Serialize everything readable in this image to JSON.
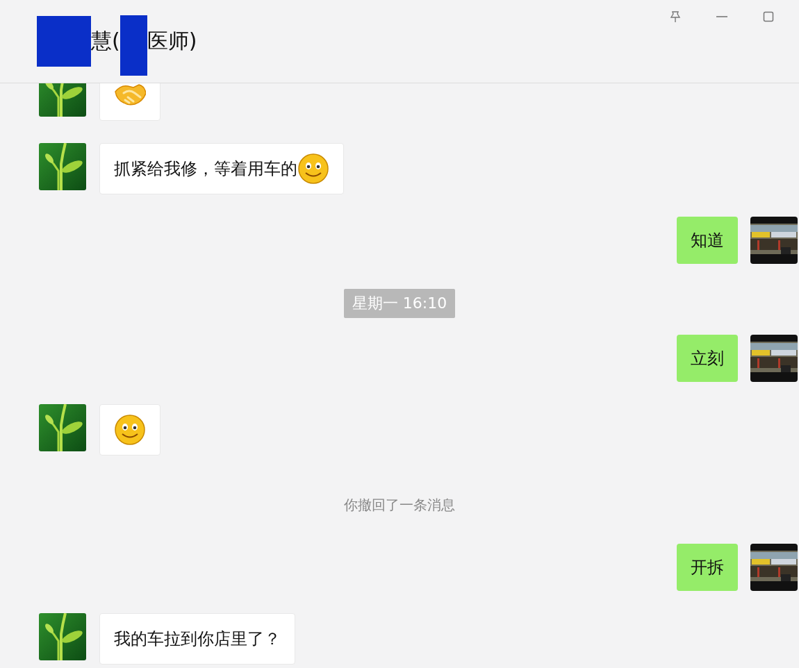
{
  "window": {
    "title": [
      {
        "kind": "redaction"
      },
      {
        "kind": "text",
        "text": "慧("
      },
      {
        "kind": "redaction"
      },
      {
        "kind": "text",
        "text": "医师)"
      }
    ],
    "controls": [
      {
        "kind": "pin"
      },
      {
        "kind": "minimize"
      },
      {
        "kind": "maximize"
      }
    ]
  },
  "messages": [
    {
      "kind": "incoming",
      "emoji": {
        "kind": "handshake"
      }
    },
    {
      "kind": "incoming",
      "text": "抓紧给我修，等着用车的",
      "emoji": {
        "kind": "smile"
      }
    },
    {
      "kind": "outgoing",
      "text": "知道"
    },
    {
      "kind": "time",
      "text": "星期一 16:10"
    },
    {
      "kind": "outgoing",
      "text": "立刻"
    },
    {
      "kind": "incoming",
      "emoji": {
        "kind": "smile"
      }
    },
    {
      "kind": "notice",
      "text": "你撤回了一条消息"
    },
    {
      "kind": "outgoing",
      "text": "开拆"
    },
    {
      "kind": "incoming",
      "text": "我的车拉到你店里了？"
    }
  ]
}
